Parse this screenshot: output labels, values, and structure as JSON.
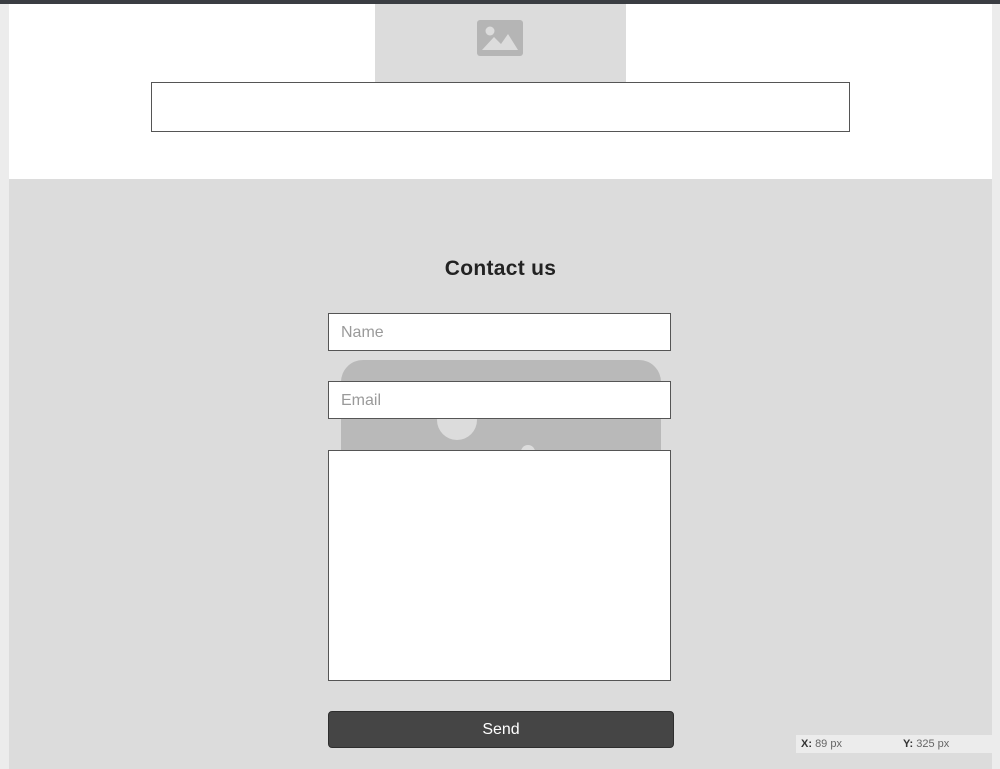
{
  "contact": {
    "title": "Contact us",
    "name_placeholder": "Name",
    "email_placeholder": "Email",
    "send_label": "Send"
  },
  "coords": {
    "x_label": "X:",
    "x_value": "89 px",
    "y_label": "Y:",
    "y_value": "325 px"
  },
  "icons": {
    "hero_image": "image-icon",
    "background_image": "image-placeholder"
  },
  "colors": {
    "section_background": "#dcdcdc",
    "button_background": "#454545",
    "button_text": "#ffffff",
    "top_bar": "#3a3d42"
  }
}
